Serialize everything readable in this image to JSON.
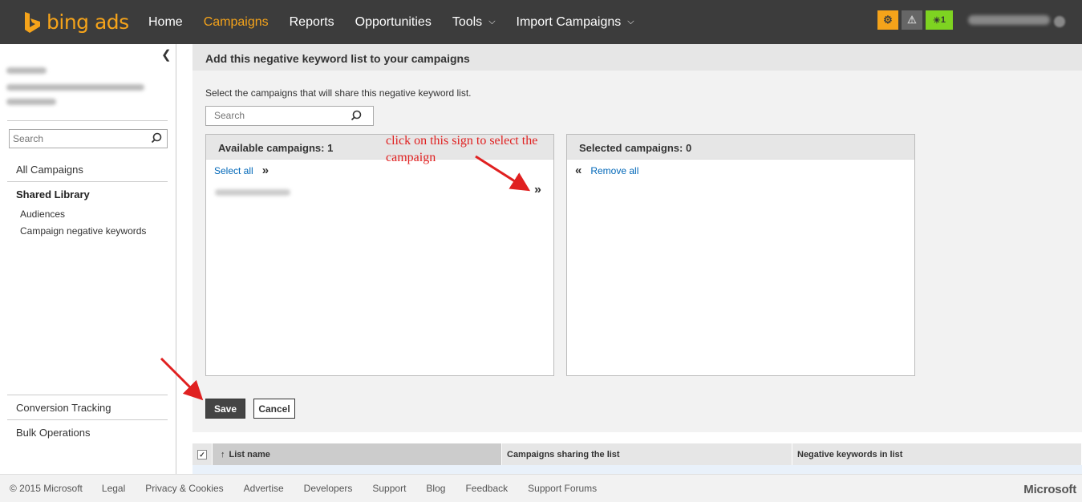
{
  "brand": {
    "logo_text": "bing ads",
    "accent": "#f5a31a"
  },
  "nav": {
    "items": [
      {
        "label": "Home",
        "active": false,
        "dropdown": false
      },
      {
        "label": "Campaigns",
        "active": true,
        "dropdown": false
      },
      {
        "label": "Reports",
        "active": false,
        "dropdown": false
      },
      {
        "label": "Opportunities",
        "active": false,
        "dropdown": false
      },
      {
        "label": "Tools",
        "active": false,
        "dropdown": true
      },
      {
        "label": "Import Campaigns",
        "active": false,
        "dropdown": true
      }
    ],
    "notifications": {
      "info_icon": "info-icon",
      "warning_icon": "warning-icon",
      "bulb_icon": "lightbulb-icon",
      "bulb_count": "1"
    }
  },
  "sidebar": {
    "search_placeholder": "Search",
    "all_campaigns": "All Campaigns",
    "shared_library": "Shared Library",
    "audiences": "Audiences",
    "campaign_negative_keywords": "Campaign negative keywords",
    "conversion_tracking": "Conversion Tracking",
    "bulk_operations": "Bulk Operations"
  },
  "panel": {
    "title": "Add this negative keyword list to your campaigns",
    "instruction": "Select the campaigns that will share this negative keyword list.",
    "search_placeholder": "Search",
    "available_title": "Available campaigns:",
    "available_count": "1",
    "select_all": "Select all",
    "selected_title": "Selected campaigns:",
    "selected_count": "0",
    "remove_all": "Remove all",
    "save": "Save",
    "cancel": "Cancel"
  },
  "annotation": {
    "text": "click on this sign to select the campaign",
    "color": "#e02020"
  },
  "table": {
    "columns": [
      "List name",
      "Campaigns sharing the list",
      "Negative keywords in list"
    ]
  },
  "footer": {
    "copyright": "© 2015 Microsoft",
    "links": [
      "Legal",
      "Privacy & Cookies",
      "Advertise",
      "Developers",
      "Support",
      "Blog",
      "Feedback",
      "Support Forums"
    ],
    "brand": "Microsoft"
  }
}
